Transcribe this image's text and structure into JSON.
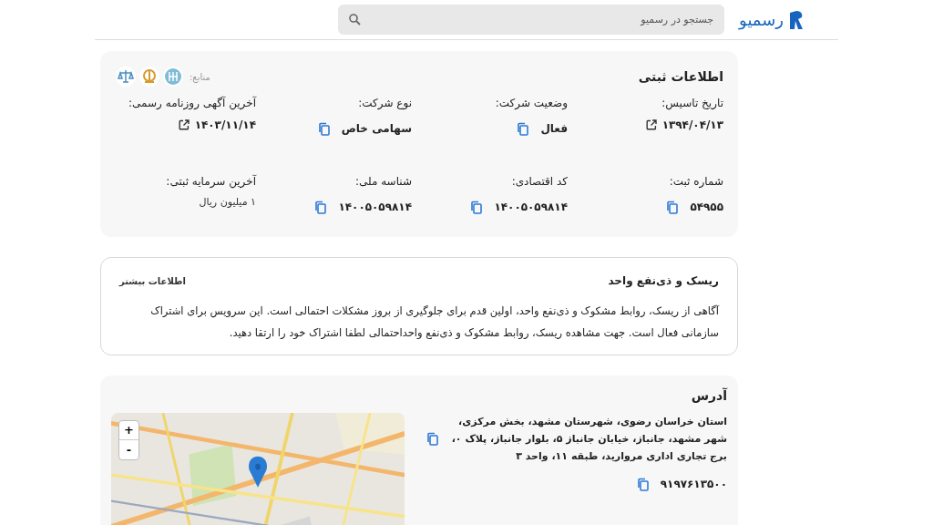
{
  "header": {
    "logo_text": "رسمیو",
    "search": {
      "placeholder": "جستجو در رسمیو"
    }
  },
  "registration": {
    "title": "اطلاعات ثبتی",
    "sources_label": "منابع:",
    "fields": [
      {
        "label": "تاریخ تاسیس:",
        "value": "۱۳۹۴/۰۴/۱۳",
        "kind": "link"
      },
      {
        "label": "وضعیت شرکت:",
        "value": "فعال",
        "kind": "copy"
      },
      {
        "label": "نوع شرکت:",
        "value": "سهامی خاص",
        "kind": "copy"
      },
      {
        "label": "آخرین آگهی روزنامه رسمی:",
        "value": "۱۴۰۳/۱۱/۱۴",
        "kind": "link"
      },
      {
        "label": "شماره ثبت:",
        "value": "۵۴۹۵۵",
        "kind": "copy"
      },
      {
        "label": "کد اقتصادی:",
        "value": "۱۴۰۰۵۰۵۹۸۱۴",
        "kind": "copy"
      },
      {
        "label": "شناسه ملی:",
        "value": "۱۴۰۰۵۰۵۹۸۱۴",
        "kind": "copy"
      },
      {
        "label": "آخرین سرمایه ثبتی:",
        "value": "۱ میلیون ریال",
        "kind": "plain"
      }
    ]
  },
  "risk": {
    "title": "ریسک و ذی‌نفع واحد",
    "more_link": "اطلاعات بیشتر",
    "text": "آگاهی از ریسک، روابط مشکوک و ذی‌نفع واحد، اولین قدم برای جلوگیری از بروز مشکلات احتمالی است. این سرویس برای اشتراک سازمانی فعال است. جهت مشاهده ریسک، روابط مشکوک و ذی‌نفع واحداحتمالی لطفا اشتراک خود را ارتقا دهید."
  },
  "address": {
    "title": "آدرس",
    "text": "استان خراسان رضوی، شهرستان مشهد، بخش مرکزی، شهر مشهد، جانباز، خیابان جانباز ۵، بلوار جانباز، پلاک ۰، برج تجاری اداری مروارید، طبقه ۱۱، واحد ۳",
    "phone": "۹۱۹۷۶۱۳۵۰۰",
    "map": {
      "zoom_in": "+",
      "zoom_out": "-"
    }
  }
}
